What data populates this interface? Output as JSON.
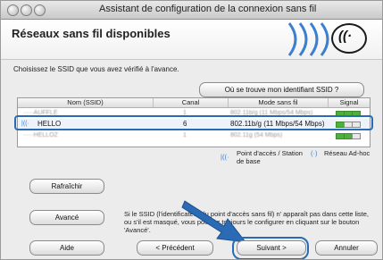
{
  "window": {
    "title": "Assistant de configuration de la connexion sans fil"
  },
  "header": {
    "title": "Réseaux sans fil disponibles"
  },
  "instruction": "Choisissez le SSID que vous avez vérifié à l'avance.",
  "ssid_help_button": "Où se trouve mon identifiant SSID ?",
  "table": {
    "columns": [
      "Nom (SSID)",
      "Canal",
      "Mode sans fil",
      "Signal"
    ],
    "rows": [
      {
        "name": "·····AUFFLE",
        "channel": "1",
        "mode": "802.11b/g (11 Mbps/54 Mbps)",
        "selected": false
      },
      {
        "name": "HELLO",
        "channel": "6",
        "mode": "802.11b/g (11 Mbps/54 Mbps)",
        "selected": true
      },
      {
        "name": "·····HELLOZ",
        "channel": "1",
        "mode": "802.11g (54 Mbps)",
        "selected": false
      }
    ]
  },
  "legend": {
    "access_point": "Point d'accès / Station de base",
    "adhoc": "Réseau Ad-hoc"
  },
  "buttons": {
    "refresh": "Rafraîchir",
    "advanced": "Avancé",
    "help": "Aide",
    "previous": "< Précédent",
    "next": "Suivant >",
    "cancel": "Annuler"
  },
  "advanced_note": "Si le SSID (l'identificateur du point d'accès sans fil) n' apparaît pas dans cette liste, ou s'il est masqué, vous pourrez toujours le configurer en cliquant sur le bouton 'Avancé'.",
  "colors": {
    "highlight": "#2b6bb5",
    "arrow": "#2b6bb5",
    "signal_on": "#4db03a"
  }
}
